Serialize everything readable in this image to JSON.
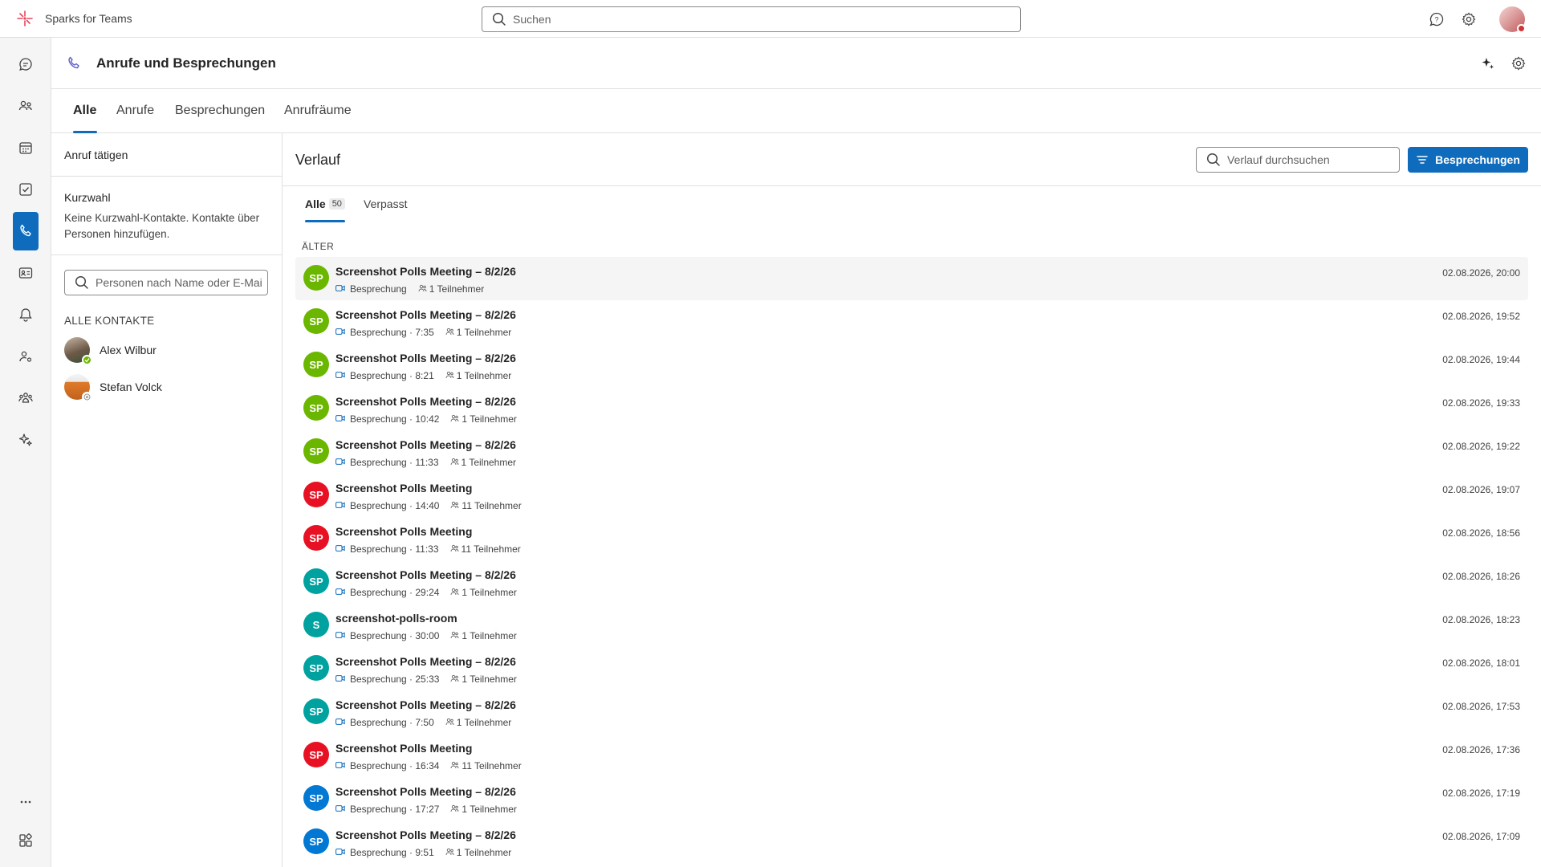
{
  "app": {
    "name": "Sparks for Teams",
    "search_placeholder": "Suchen"
  },
  "header": {
    "title": "Anrufe und Besprechungen"
  },
  "tabs": [
    {
      "label": "Alle"
    },
    {
      "label": "Anrufe"
    },
    {
      "label": "Besprechungen"
    },
    {
      "label": "Anrufräume"
    }
  ],
  "left_pane": {
    "make_call": "Anruf tätigen",
    "speed_dial_title": "Kurzwahl",
    "speed_dial_desc": "Keine Kurzwahl-Kontakte. Kontakte über Personen hinzufügen.",
    "people_search_placeholder": "Personen nach Name oder E-Mai",
    "all_contacts_label": "ALLE KONTAKTE",
    "contacts": [
      {
        "name": "Alex Wilbur",
        "presence": "available"
      },
      {
        "name": "Stefan Volck",
        "presence": "offline"
      }
    ]
  },
  "history": {
    "title": "Verlauf",
    "search_placeholder": "Verlauf durchsuchen",
    "filter_button": "Besprechungen",
    "subtabs": {
      "all_label": "Alle",
      "all_count": "50",
      "missed_label": "Verpasst"
    },
    "section_label": "ÄLTER",
    "items": [
      {
        "initials": "SP",
        "color": "#6bb700",
        "title": "Screenshot Polls Meeting – 8/2/26",
        "meta": "Besprechung",
        "participants": "1 Teilnehmer",
        "time": "02.08.2026, 20:00"
      },
      {
        "initials": "SP",
        "color": "#6bb700",
        "title": "Screenshot Polls Meeting – 8/2/26",
        "meta": "Besprechung · 7:35",
        "participants": "1 Teilnehmer",
        "time": "02.08.2026, 19:52"
      },
      {
        "initials": "SP",
        "color": "#6bb700",
        "title": "Screenshot Polls Meeting – 8/2/26",
        "meta": "Besprechung · 8:21",
        "participants": "1 Teilnehmer",
        "time": "02.08.2026, 19:44"
      },
      {
        "initials": "SP",
        "color": "#6bb700",
        "title": "Screenshot Polls Meeting – 8/2/26",
        "meta": "Besprechung · 10:42",
        "participants": "1 Teilnehmer",
        "time": "02.08.2026, 19:33"
      },
      {
        "initials": "SP",
        "color": "#6bb700",
        "title": "Screenshot Polls Meeting – 8/2/26",
        "meta": "Besprechung · 11:33",
        "participants": "1 Teilnehmer",
        "time": "02.08.2026, 19:22"
      },
      {
        "initials": "SP",
        "color": "#e81123",
        "title": "Screenshot Polls Meeting",
        "meta": "Besprechung · 14:40",
        "participants": "11 Teilnehmer",
        "time": "02.08.2026, 19:07"
      },
      {
        "initials": "SP",
        "color": "#e81123",
        "title": "Screenshot Polls Meeting",
        "meta": "Besprechung · 11:33",
        "participants": "11 Teilnehmer",
        "time": "02.08.2026, 18:56"
      },
      {
        "initials": "SP",
        "color": "#00a2a0",
        "title": "Screenshot Polls Meeting – 8/2/26",
        "meta": "Besprechung · 29:24",
        "participants": "1 Teilnehmer",
        "time": "02.08.2026, 18:26"
      },
      {
        "initials": "S",
        "color": "#00a2a0",
        "title": "screenshot-polls-room",
        "meta": "Besprechung · 30:00",
        "participants": "1 Teilnehmer",
        "time": "02.08.2026, 18:23"
      },
      {
        "initials": "SP",
        "color": "#00a2a0",
        "title": "Screenshot Polls Meeting – 8/2/26",
        "meta": "Besprechung · 25:33",
        "participants": "1 Teilnehmer",
        "time": "02.08.2026, 18:01"
      },
      {
        "initials": "SP",
        "color": "#00a2a0",
        "title": "Screenshot Polls Meeting – 8/2/26",
        "meta": "Besprechung · 7:50",
        "participants": "1 Teilnehmer",
        "time": "02.08.2026, 17:53"
      },
      {
        "initials": "SP",
        "color": "#e81123",
        "title": "Screenshot Polls Meeting",
        "meta": "Besprechung · 16:34",
        "participants": "11 Teilnehmer",
        "time": "02.08.2026, 17:36"
      },
      {
        "initials": "SP",
        "color": "#0078d4",
        "title": "Screenshot Polls Meeting – 8/2/26",
        "meta": "Besprechung · 17:27",
        "participants": "1 Teilnehmer",
        "time": "02.08.2026, 17:19"
      },
      {
        "initials": "SP",
        "color": "#0078d4",
        "title": "Screenshot Polls Meeting – 8/2/26",
        "meta": "Besprechung · 9:51",
        "participants": "1 Teilnehmer",
        "time": "02.08.2026, 17:09"
      }
    ]
  }
}
